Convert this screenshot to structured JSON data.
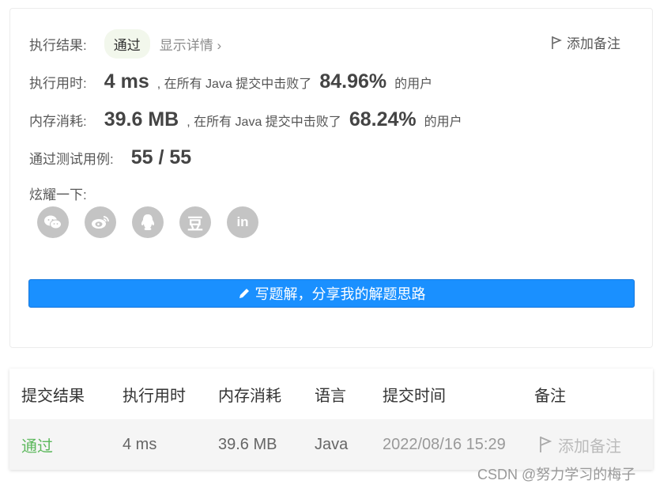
{
  "result": {
    "label": "执行结果:",
    "status": "通过",
    "detail_link": "显示详情",
    "note_link": "添加备注"
  },
  "runtime": {
    "label": "执行用时:",
    "value": "4 ms",
    "desc": ", 在所有 Java 提交中击败了",
    "percent": "84.96%",
    "suffix": "的用户"
  },
  "memory": {
    "label": "内存消耗:",
    "value": "39.6 MB",
    "desc": ", 在所有 Java 提交中击败了",
    "percent": "68.24%",
    "suffix": "的用户"
  },
  "tests": {
    "label": "通过测试用例:",
    "value": "55 / 55"
  },
  "share": {
    "label": "炫耀一下:",
    "icons": [
      "wechat-icon",
      "weibo-icon",
      "qq-icon",
      "douban-icon",
      "linkedin-icon"
    ],
    "douban_glyph": "豆",
    "linkedin_glyph": "in"
  },
  "write_button": "写题解，分享我的解题思路",
  "table": {
    "headers": [
      "提交结果",
      "执行用时",
      "内存消耗",
      "语言",
      "提交时间",
      "备注"
    ],
    "row": {
      "result": "通过",
      "runtime": "4 ms",
      "memory": "39.6 MB",
      "language": "Java",
      "time": "2022/08/16 15:29",
      "note": "添加备注"
    }
  },
  "watermark": "CSDN @努力学习的梅子",
  "colors": {
    "accent": "#1a90ff",
    "success": "#5cb85c",
    "badge_bg": "#f2f7ec"
  }
}
